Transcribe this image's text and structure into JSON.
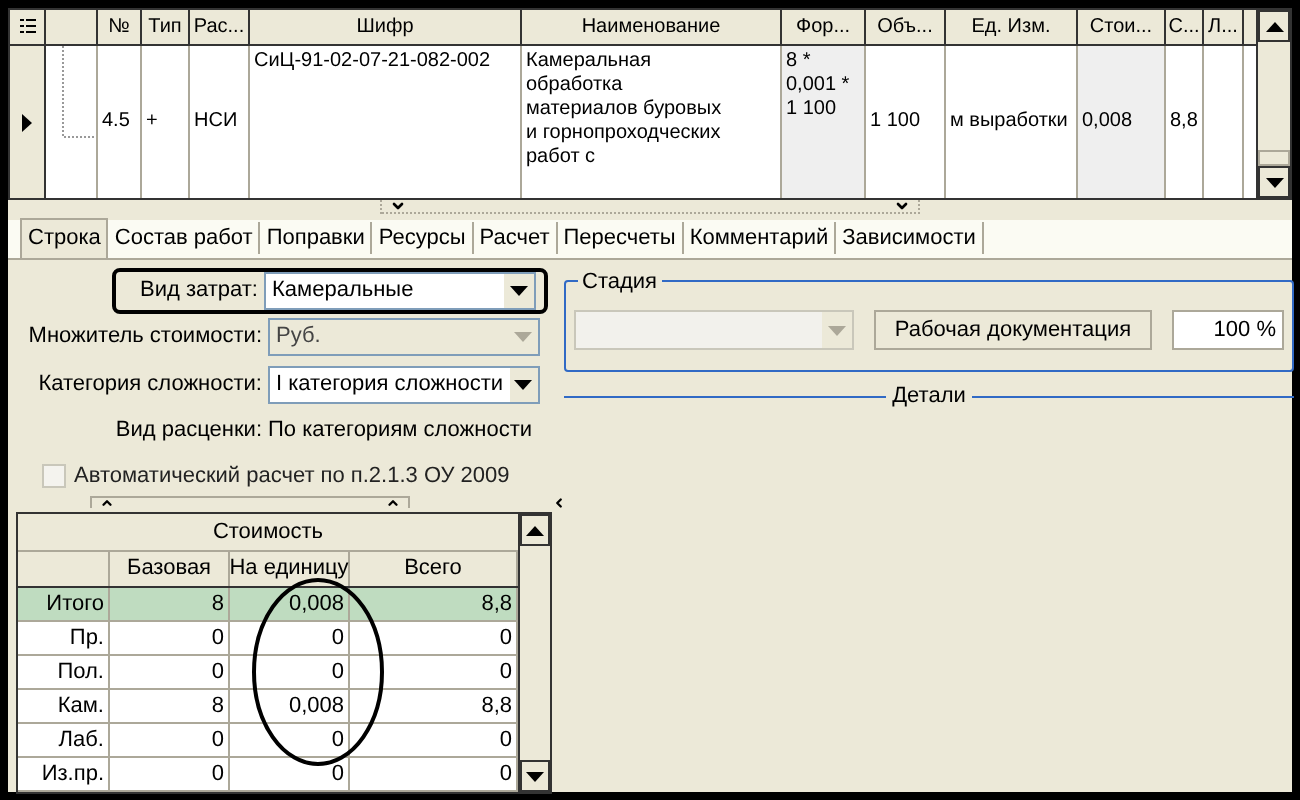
{
  "grid": {
    "columns": [
      "№",
      "Тип",
      "Рас...",
      "Шифр",
      "Наименование",
      "Фор...",
      "Объ...",
      "Ед. Изм.",
      "Стои...",
      "С...",
      "Л..."
    ],
    "rows": [
      {
        "selected": true,
        "cells": [
          "4.5",
          "+",
          "НСИ",
          "СиЦ-91-02-07-21-082-002",
          "Камеральная\nобработка\nматериалов буровых\nи горнопроходческих\nработ с",
          "8 *\n0,001 *\n1 100",
          "1 100",
          "м выработки",
          "0,008",
          "8,8"
        ]
      }
    ]
  },
  "tabs": [
    {
      "label": "Строка",
      "selected": true
    },
    {
      "label": "Состав работ",
      "selected": false
    },
    {
      "label": "Поправки",
      "selected": false
    },
    {
      "label": "Ресурсы",
      "selected": false
    },
    {
      "label": "Расчет",
      "selected": false
    },
    {
      "label": "Пересчеты",
      "selected": false
    },
    {
      "label": "Комментарий",
      "selected": false
    },
    {
      "label": "Зависимости",
      "selected": false
    }
  ],
  "form": {
    "cost_type": {
      "label": "Вид затрат:",
      "value": "Камеральные",
      "disabled": false
    },
    "multiplier": {
      "label": "Множитель стоимости:",
      "value": "Руб.",
      "disabled": true
    },
    "category": {
      "label": "Категория сложности:",
      "value": "I категория сложности",
      "disabled": false
    },
    "pricing": {
      "label": "Вид расценки:",
      "value": "По категориям сложности"
    },
    "auto_calc": {
      "label": "Автоматический расчет по п.2.1.3 ОУ 2009",
      "checked": false,
      "disabled": true
    }
  },
  "stage": {
    "title": "Стадия",
    "select_disabled": true,
    "button": "Рабочая документация",
    "percent": "100 %"
  },
  "details": {
    "title": "Детали"
  },
  "cost_table": {
    "title": "Стоимость",
    "columns": [
      "Базовая",
      "На единицу",
      "Всего"
    ],
    "rows": [
      {
        "label": "Итого",
        "selected": true,
        "values": [
          "8",
          "0,008",
          "8,8"
        ]
      },
      {
        "label": "Пр.",
        "selected": false,
        "values": [
          "0",
          "0",
          "0"
        ]
      },
      {
        "label": "Пол.",
        "selected": false,
        "values": [
          "0",
          "0",
          "0"
        ]
      },
      {
        "label": "Кам.",
        "selected": false,
        "values": [
          "8",
          "0,008",
          "8,8"
        ]
      },
      {
        "label": "Лаб.",
        "selected": false,
        "values": [
          "0",
          "0",
          "0"
        ]
      },
      {
        "label": "Из.пр.",
        "selected": false,
        "values": [
          "0",
          "0",
          "0"
        ]
      }
    ]
  }
}
